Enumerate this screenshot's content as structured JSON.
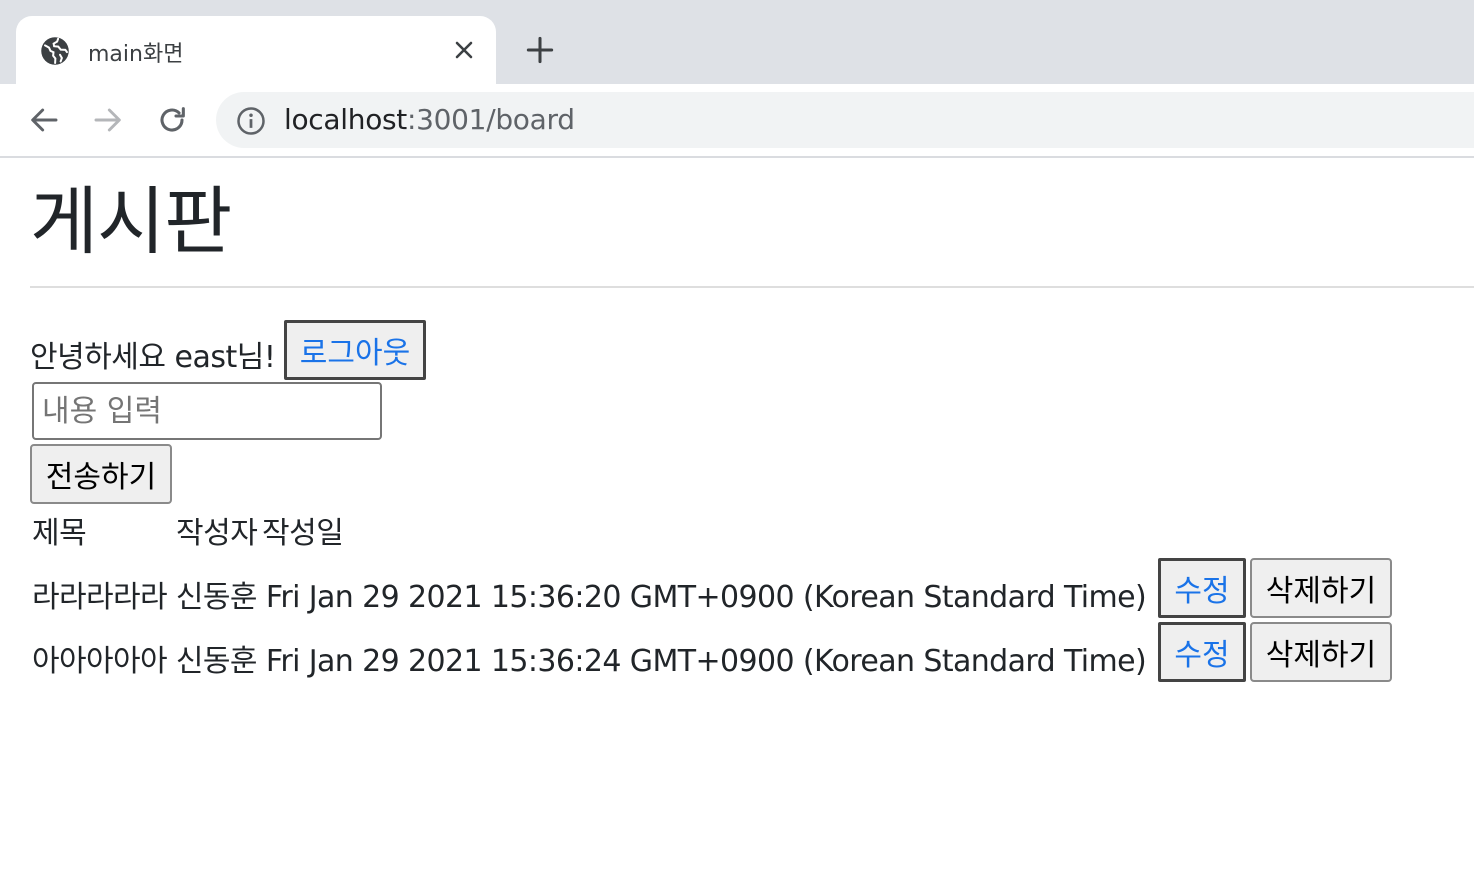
{
  "browser": {
    "tab_title": "main화면",
    "url_host": "localhost",
    "url_rest": ":3001/board",
    "icons": {
      "favicon": "globe-icon",
      "close": "close-icon",
      "new_tab": "plus-icon",
      "back": "arrow-left-icon",
      "forward": "arrow-right-icon",
      "reload": "reload-icon",
      "site_info": "info-icon"
    }
  },
  "page": {
    "title": "게시판",
    "greeting": "안녕하세요 east님!",
    "logout_label": "로그아웃",
    "input_placeholder": "내용 입력",
    "input_value": "",
    "submit_label": "전송하기"
  },
  "table": {
    "headers": {
      "title": "제목",
      "author": "작성자",
      "date": "작성일"
    },
    "rows": [
      {
        "text": "라라라라라 신동훈 Fri Jan 29 2021 15:36:20 GMT+0900 (Korean Standard Time)",
        "edit_label": "수정",
        "delete_label": "삭제하기"
      },
      {
        "text": "아아아아아 신동훈 Fri Jan 29 2021 15:36:24 GMT+0900 (Korean Standard Time)",
        "edit_label": "수정",
        "delete_label": "삭제하기"
      }
    ]
  },
  "colors": {
    "tabstrip": "#dee1e6",
    "omnibox": "#f1f3f4",
    "focus_text": "#1a73e8",
    "button_bg": "#efefef"
  }
}
